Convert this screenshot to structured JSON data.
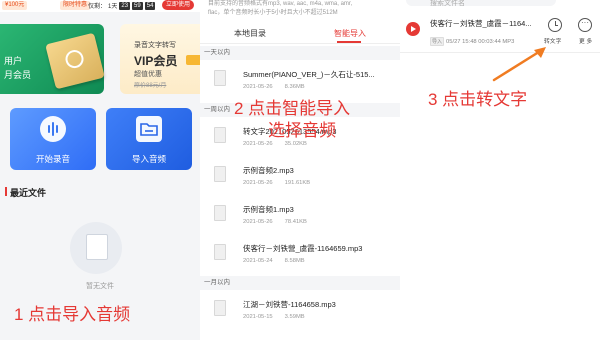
{
  "left": {
    "promo_tag": "¥100元",
    "promo_tag2": "限时特惠",
    "countdown_label": "仅剩：",
    "countdown_day": "1天",
    "countdown_h": "23",
    "countdown_m": "59",
    "countdown_s": "54",
    "use_now": "立即使用",
    "vip_line1": "用户",
    "vip_line2": "月会员",
    "promo_small": "录音文字转写",
    "promo_big": "VIP会员",
    "promo_sub": "超值优惠",
    "promo_strike": "原价88元/月",
    "record_label": "开始录音",
    "import_label": "导入音频",
    "recent_title": "最近文件",
    "empty_text": "暂无文件"
  },
  "middle": {
    "info_line1": "目前支持的音频格式有mp3, wav, aac, m4a, wma, amr,",
    "info_line2": "flac，单个音频时长小于5小时且大小不超过512M",
    "tab_local": "本地目录",
    "tab_smart": "智能导入",
    "group_day": "一天以内",
    "group_week": "一周以内",
    "group_month": "一月以内",
    "files": [
      {
        "name": "Summer(PIANO_VER_)－久石让-515...",
        "date": "2021-05-26",
        "size": "8.36MB"
      },
      {
        "name": "转文字2021052613554.mp3",
        "date": "2021-05-26",
        "size": "35.02KB"
      },
      {
        "name": "示例音频2.mp3",
        "date": "2021-05-26",
        "size": "191.61KB"
      },
      {
        "name": "示例音频1.mp3",
        "date": "2021-05-26",
        "size": "78.41KB"
      },
      {
        "name": "侠客行－刘铁營_虞霞-1164659.mp3",
        "date": "2021-05-24",
        "size": "8.58MB"
      },
      {
        "name": "江湖－刘铁营-1164658.mp3",
        "date": "2021-05-15",
        "size": "3.59MB"
      }
    ]
  },
  "right": {
    "search_placeholder": "搜索文件名",
    "item_name": "侠客行－刘铁营_虞霞－1164...",
    "item_badge": "导入",
    "item_meta": "05/27 15:48  00:03:44  MP3",
    "convert_label": "转文字",
    "more_label": "更 多"
  },
  "annotations": {
    "note1": "1 点击导入音频",
    "note2": "2 点击智能导入",
    "note2b": "选择音频",
    "note3": "3 点击转文字",
    "color": "#e53935"
  }
}
